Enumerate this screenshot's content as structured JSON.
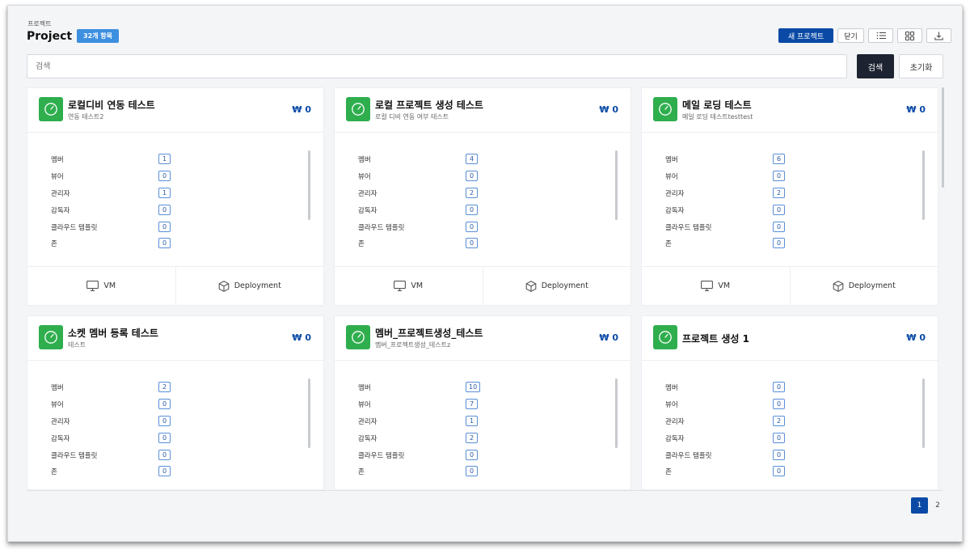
{
  "header": {
    "breadcrumb": "프로젝트",
    "title": "Project",
    "count_badge": "32개 항목"
  },
  "toolbar": {
    "new_project": "새 프로젝트",
    "close": "닫기",
    "list_view_icon": "list-icon",
    "grid_view_icon": "grid-icon",
    "download_icon": "download-icon"
  },
  "search": {
    "placeholder": "검색",
    "search_button": "검색",
    "reset_button": "초기화"
  },
  "labels": {
    "member": "멤버",
    "viewer": "뷰어",
    "admin": "관리자",
    "supervisor": "감독자",
    "cloud_template": "클라우드 템플릿",
    "zone": "존",
    "vm": "VM",
    "deployment": "Deployment"
  },
  "projects": [
    {
      "title": "로컬디비 연동 테스트",
      "subtitle": "연동 테스트2",
      "price": "₩ 0",
      "stats": [
        "1",
        "0",
        "1",
        "0",
        "0",
        "0"
      ]
    },
    {
      "title": "로컬 프로젝트 생성 테스트",
      "subtitle": "로컬 디비 연동 여부 테스트",
      "price": "₩ 0",
      "stats": [
        "4",
        "0",
        "2",
        "0",
        "0",
        "0"
      ]
    },
    {
      "title": "메일 로딩 테스트",
      "subtitle": "메일 로딩 테스트testtest",
      "price": "₩ 0",
      "stats": [
        "6",
        "0",
        "2",
        "0",
        "0",
        "0"
      ]
    },
    {
      "title": "소켓 멤버 등록 테스트",
      "subtitle": "테스트",
      "price": "₩ 0",
      "stats": [
        "2",
        "0",
        "0",
        "0",
        "0",
        "0"
      ]
    },
    {
      "title": "멤버_프로젝트생성_테스트",
      "subtitle": "멤버_프로젝트생성_테스트z",
      "price": "₩ 0",
      "stats": [
        "10",
        "7",
        "1",
        "2",
        "0",
        "0"
      ]
    },
    {
      "title": "프로젝트 생성 1",
      "subtitle": "",
      "price": "₩ 0",
      "stats": [
        "0",
        "0",
        "2",
        "0",
        "0",
        "0"
      ]
    }
  ],
  "pagination": {
    "current": "1",
    "next": "2"
  },
  "colors": {
    "accent": "#0a4aa6",
    "badge": "#3d8fe0",
    "project_icon": "#2fae4e",
    "search_button": "#1d2330"
  }
}
